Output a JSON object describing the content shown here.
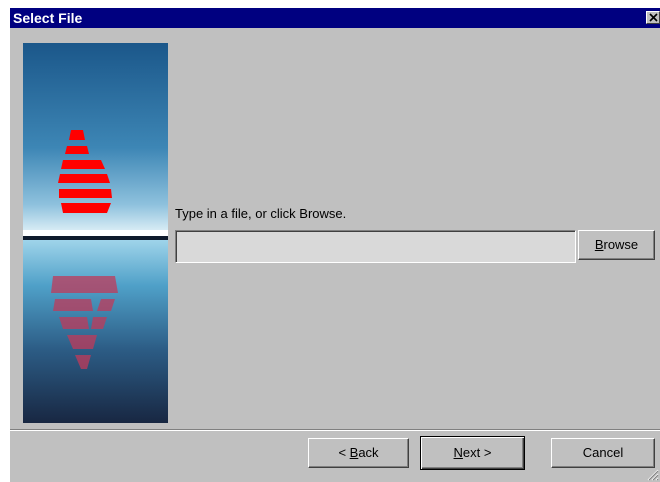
{
  "window": {
    "title": "Select File"
  },
  "icons": {
    "close": "close-icon",
    "side_image": "wizard-logo-image",
    "size_grip": "size-grip-icon"
  },
  "colors": {
    "title_bar": "#000080",
    "dialog_face": "#c0c0c0",
    "logo_red": "#ff0000",
    "image_top_blue": "#1e5d8f",
    "image_bottom_navy": "#1a2845"
  },
  "main": {
    "prompt": "Type in a file, or click Browse.",
    "file_value": "",
    "file_placeholder": "",
    "browse_label": "Browse",
    "browse_mnemonic": "B",
    "browse_rest": "rowse"
  },
  "footer": {
    "back_prefix": "< ",
    "back_mnemonic": "B",
    "back_rest": "ack",
    "next_mnemonic": "N",
    "next_rest": "ext >",
    "cancel_label": "Cancel"
  }
}
